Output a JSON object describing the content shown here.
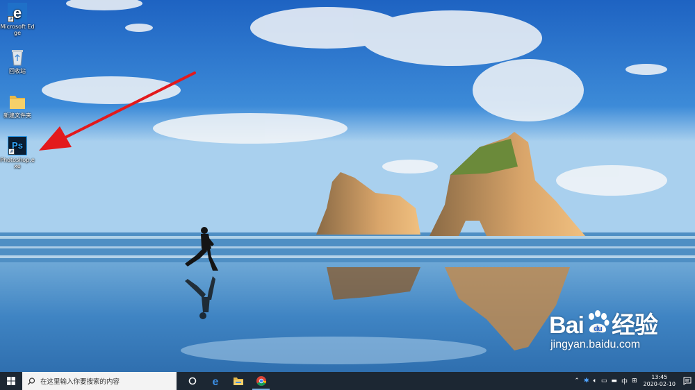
{
  "desktop": {
    "icons": [
      {
        "label": "Microsoft Edge",
        "icon": "edge-icon"
      },
      {
        "label": "回收站",
        "icon": "recycle-bin-icon"
      },
      {
        "label": "新建文件夹",
        "icon": "folder-icon"
      },
      {
        "label": "Photoshop.exe",
        "icon": "photoshop-icon"
      }
    ],
    "photoshop_glyph": "Ps"
  },
  "watermark": {
    "brand_left": "Bai",
    "brand_right": "经验",
    "url": "jingyan.baidu.com"
  },
  "taskbar": {
    "search_placeholder": "在这里输入你要搜索的内容",
    "pinned": [
      "cortana-icon",
      "edge-icon",
      "file-explorer-icon",
      "chrome-icon"
    ],
    "tray": {
      "ime": "中",
      "time": "13:45",
      "date": "2020-02-10"
    }
  },
  "colors": {
    "taskbar": "#1c2733",
    "arrow": "#e3191c",
    "accent": "#7aaee0"
  }
}
